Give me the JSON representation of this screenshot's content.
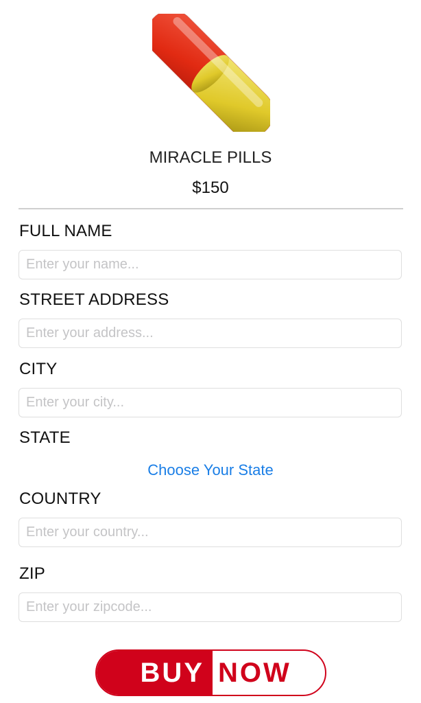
{
  "product": {
    "image_icon": "pill-capsule-icon",
    "name": "MIRACLE PILLS",
    "price": "$150"
  },
  "form": {
    "full_name": {
      "label": "FULL NAME",
      "placeholder": "Enter your name...",
      "value": ""
    },
    "street_address": {
      "label": "STREET ADDRESS",
      "placeholder": "Enter your address...",
      "value": ""
    },
    "city": {
      "label": "CITY",
      "placeholder": "Enter your city...",
      "value": ""
    },
    "state": {
      "label": "STATE",
      "picker_label": "Choose Your State"
    },
    "country": {
      "label": "COUNTRY",
      "placeholder": "Enter your country...",
      "value": ""
    },
    "zip": {
      "label": "ZIP",
      "placeholder": "Enter your zipcode...",
      "value": ""
    }
  },
  "buy_button": {
    "left_label": "BUY",
    "right_label": "NOW"
  },
  "colors": {
    "accent_red": "#d0021b",
    "link_blue": "#1a7ee6",
    "pill_red": "#e8301c",
    "pill_yellow": "#e9d63a"
  }
}
